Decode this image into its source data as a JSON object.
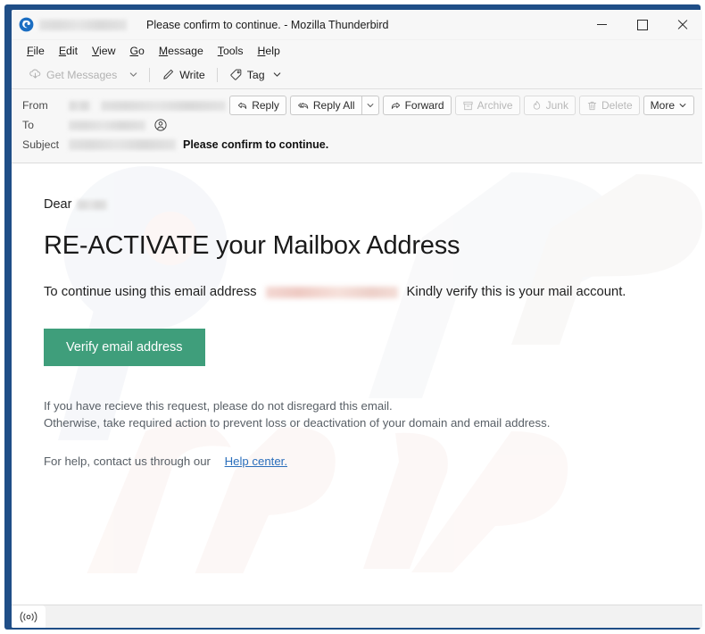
{
  "window": {
    "title": "Please confirm to continue. - Mozilla Thunderbird",
    "logo_icon": "thunderbird-logo-icon",
    "minimize_label": "Minimize",
    "maximize_label": "Maximize",
    "close_label": "Close",
    "border_color": "#1f4e87"
  },
  "menubar": {
    "items": [
      {
        "label": "File",
        "accesskey": "F"
      },
      {
        "label": "Edit",
        "accesskey": "E"
      },
      {
        "label": "View",
        "accesskey": "V"
      },
      {
        "label": "Go",
        "accesskey": "G"
      },
      {
        "label": "Message",
        "accesskey": "M"
      },
      {
        "label": "Tools",
        "accesskey": "T"
      },
      {
        "label": "Help",
        "accesskey": "H"
      }
    ]
  },
  "toolbar": {
    "get_messages_label": "Get Messages",
    "get_messages_icon": "download-cloud-icon",
    "get_messages_disabled": true,
    "get_messages_chevron_icon": "chevron-down-icon",
    "write_label": "Write",
    "write_icon": "pencil-icon",
    "tag_label": "Tag",
    "tag_icon": "tag-icon",
    "tag_chevron_icon": "chevron-down-icon"
  },
  "header": {
    "from_label": "From",
    "to_label": "To",
    "subject_label": "Subject",
    "from_value": "",
    "to_value": "",
    "subject_prefix_value": "",
    "subject_text": "Please confirm to continue.",
    "contact_icon": "person-circle-icon"
  },
  "actions": {
    "reply": {
      "label": "Reply",
      "icon": "reply-arrow-icon",
      "disabled": false
    },
    "reply_all": {
      "label": "Reply All",
      "icon": "reply-all-arrow-icon",
      "disabled": false
    },
    "reply_all_chevron_icon": "chevron-down-icon",
    "forward": {
      "label": "Forward",
      "icon": "forward-arrow-icon",
      "disabled": false
    },
    "archive": {
      "label": "Archive",
      "icon": "archive-box-icon",
      "disabled": true
    },
    "junk": {
      "label": "Junk",
      "icon": "flame-icon",
      "disabled": true
    },
    "delete": {
      "label": "Delete",
      "icon": "trash-icon",
      "disabled": true
    },
    "more": {
      "label": "More",
      "icon": "chevron-down-icon",
      "disabled": false
    }
  },
  "message": {
    "greeting": "Dear",
    "greeting_redacted": "",
    "heading": "RE-ACTIVATE your Mailbox Address",
    "intro_before": "To continue using this email address",
    "intro_redacted": "",
    "intro_after": "Kindly verify this is your mail account.",
    "cta_label": "Verify email address",
    "cta_color": "#3f9e7b",
    "note_line_1": "If you have recieve this request, please do not disregard this email.",
    "note_line_2": "Otherwise, take required action to prevent loss or deactivation of your domain and email address.",
    "help_text": "For help, contact us through our",
    "help_link_label": "Help center.",
    "help_link_color": "#2a6ebb",
    "watermark_text": "PCrisk.com"
  },
  "statusbar": {
    "indicator_icon": "broadcast-online-icon"
  }
}
